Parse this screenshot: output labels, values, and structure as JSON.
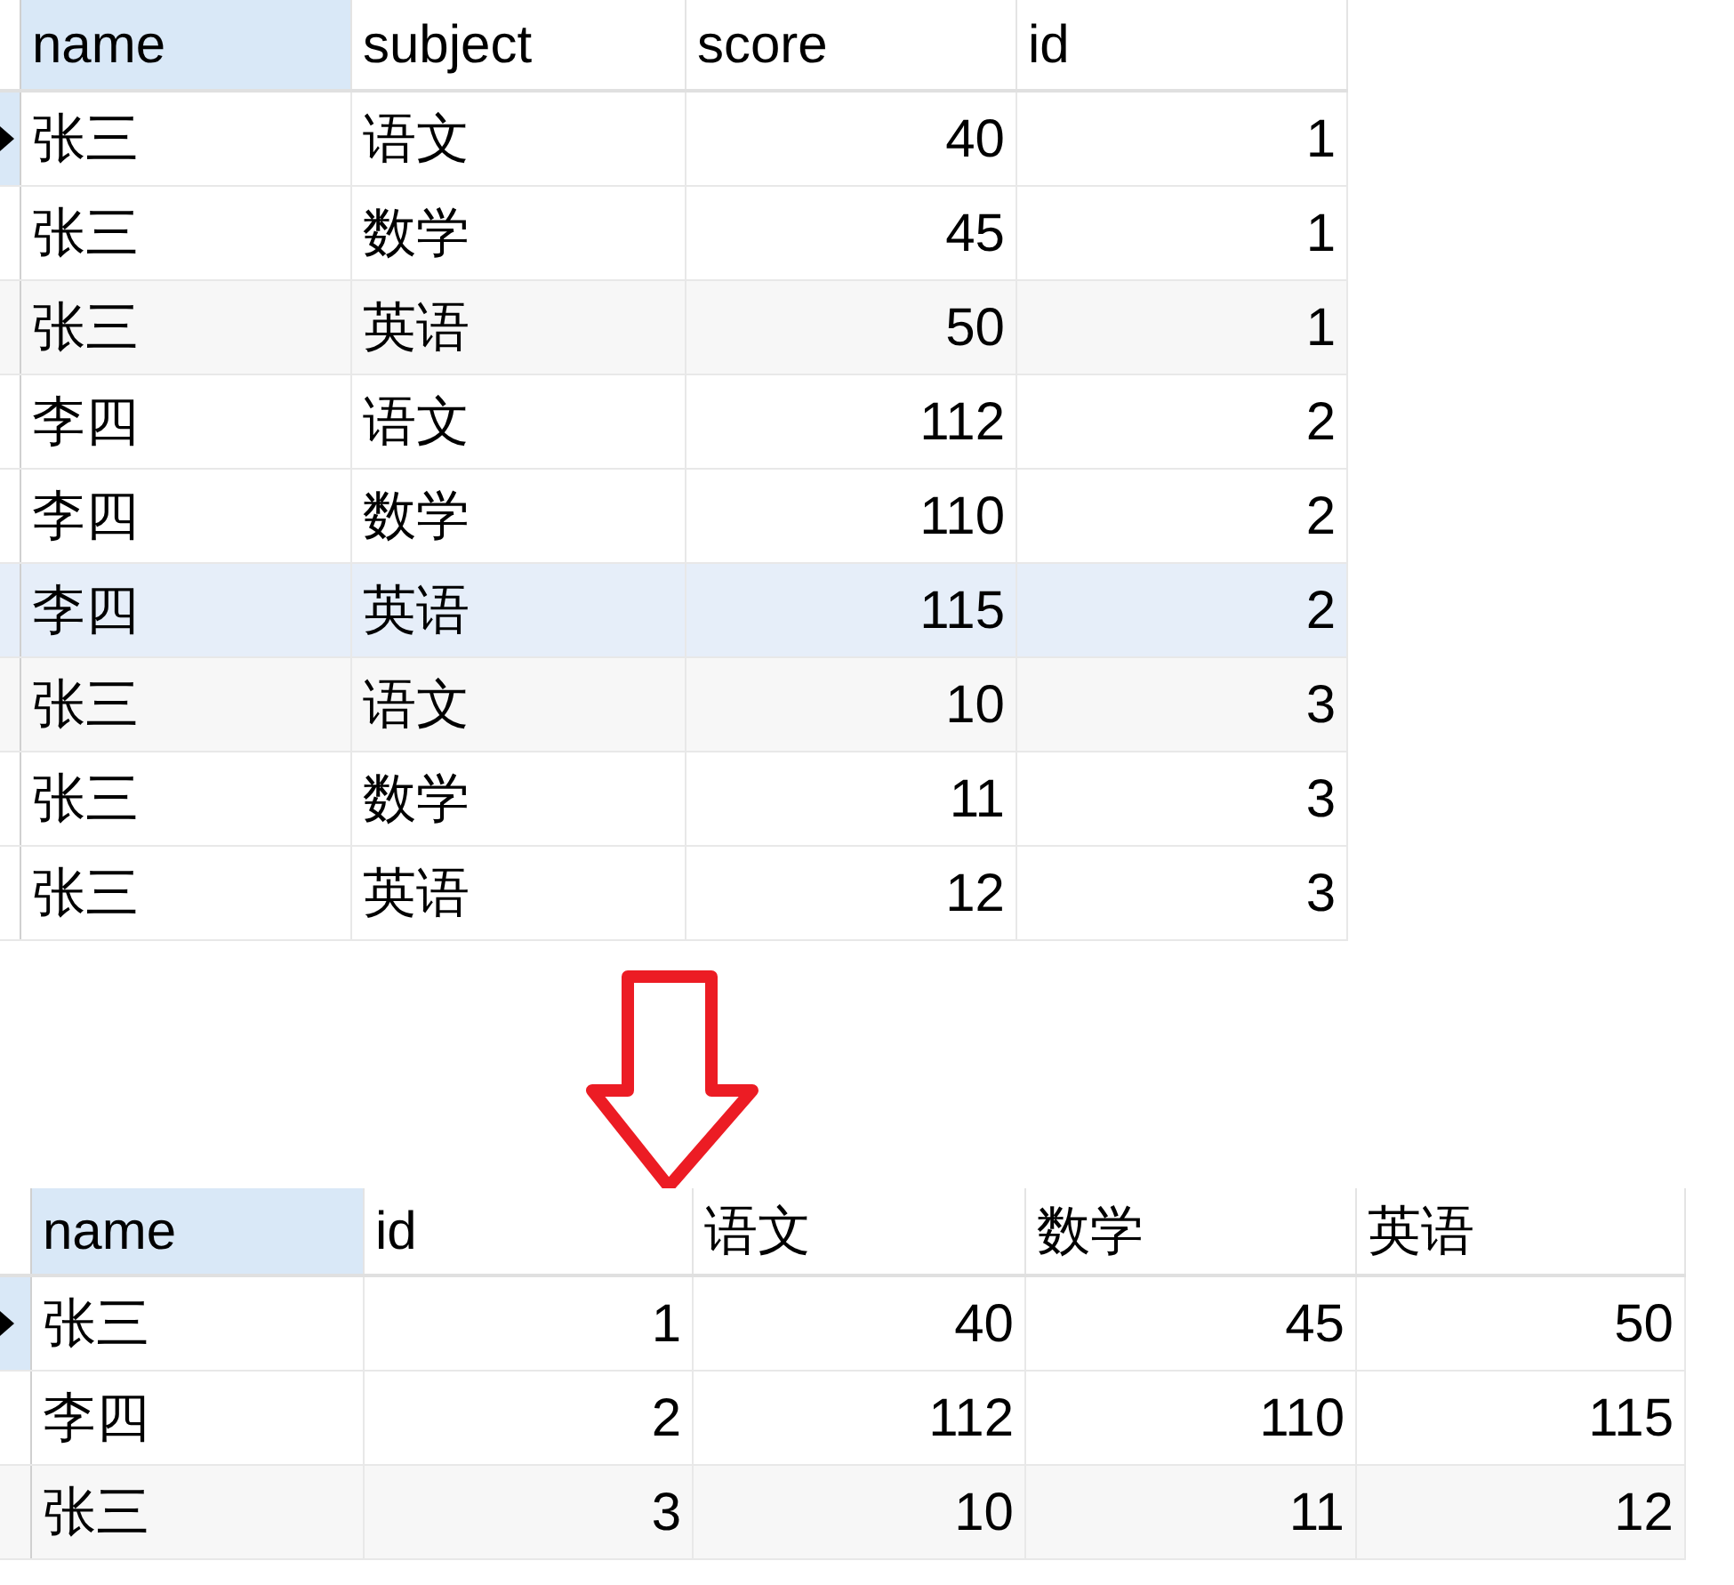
{
  "source_table": {
    "columns": [
      {
        "label": "name",
        "kind": "text"
      },
      {
        "label": "subject",
        "kind": "text"
      },
      {
        "label": "score",
        "kind": "number"
      },
      {
        "label": "id",
        "kind": "number"
      }
    ],
    "rows": [
      {
        "cells": [
          "张三",
          "语文",
          "40",
          "1"
        ],
        "selected": true,
        "highlighted": false
      },
      {
        "cells": [
          "张三",
          "数学",
          "45",
          "1"
        ],
        "selected": false,
        "highlighted": false
      },
      {
        "cells": [
          "张三",
          "英语",
          "50",
          "1"
        ],
        "selected": false,
        "highlighted": false
      },
      {
        "cells": [
          "李四",
          "语文",
          "112",
          "2"
        ],
        "selected": false,
        "highlighted": false
      },
      {
        "cells": [
          "李四",
          "数学",
          "110",
          "2"
        ],
        "selected": false,
        "highlighted": false
      },
      {
        "cells": [
          "李四",
          "英语",
          "115",
          "2"
        ],
        "selected": false,
        "highlighted": true
      },
      {
        "cells": [
          "张三",
          "语文",
          "10",
          "3"
        ],
        "selected": false,
        "highlighted": false
      },
      {
        "cells": [
          "张三",
          "数学",
          "11",
          "3"
        ],
        "selected": false,
        "highlighted": false
      },
      {
        "cells": [
          "张三",
          "英语",
          "12",
          "3"
        ],
        "selected": false,
        "highlighted": false
      }
    ]
  },
  "result_table": {
    "columns": [
      {
        "label": "name",
        "kind": "text"
      },
      {
        "label": "id",
        "kind": "number"
      },
      {
        "label": "语文",
        "kind": "number"
      },
      {
        "label": "数学",
        "kind": "number"
      },
      {
        "label": "英语",
        "kind": "number"
      }
    ],
    "rows": [
      {
        "cells": [
          "张三",
          "1",
          "40",
          "45",
          "50"
        ],
        "selected": true,
        "highlighted": false
      },
      {
        "cells": [
          "李四",
          "2",
          "112",
          "110",
          "115"
        ],
        "selected": false,
        "highlighted": false
      },
      {
        "cells": [
          "张三",
          "3",
          "10",
          "11",
          "12"
        ],
        "selected": false,
        "highlighted": false
      }
    ]
  }
}
